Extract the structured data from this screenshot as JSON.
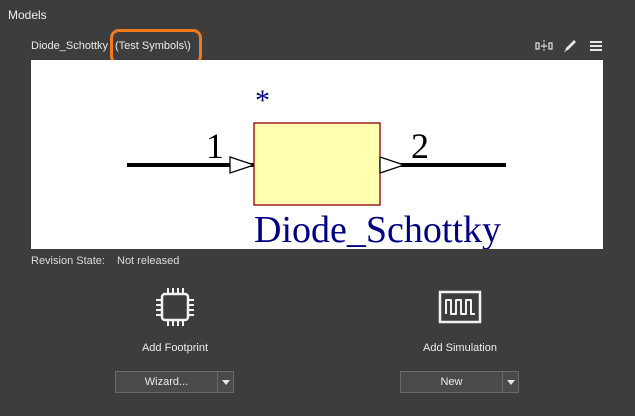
{
  "header": {
    "title": "Models"
  },
  "component": {
    "name": "Diode_Schottky",
    "library": "(Test Symbols\\)"
  },
  "toolbar": {
    "icons": [
      "compare-icon",
      "pencil-icon",
      "menu-icon"
    ]
  },
  "symbol": {
    "designator": "*",
    "pin1_number": "1",
    "pin2_number": "2",
    "comment": "Diode_Schottky",
    "body_fill": "#ffffb0",
    "body_border": "#8b0000",
    "text_color": "#000080"
  },
  "revision": {
    "label": "Revision State:",
    "value": "Not released"
  },
  "models": {
    "footprint": {
      "label": "Add Footprint",
      "icon": "chip-icon",
      "dropdown_value": "Wizard..."
    },
    "simulation": {
      "label": "Add Simulation",
      "icon": "waveform-icon",
      "dropdown_value": "New"
    }
  },
  "colors": {
    "background": "#3d3d3d",
    "highlight": "#f07a1e"
  }
}
